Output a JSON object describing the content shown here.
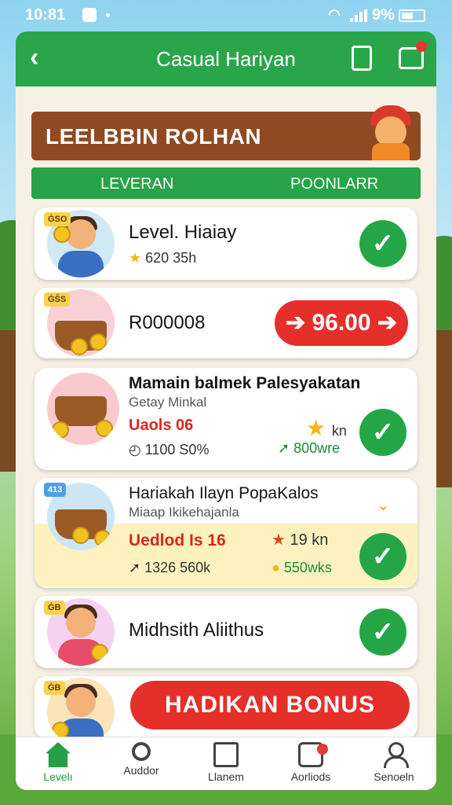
{
  "status_bar": {
    "time": "10:81",
    "battery": "9%"
  },
  "app_bar": {
    "back_icon": "‹",
    "title": "Casual Hariyan"
  },
  "banner": {
    "text": "LEELBBIN ROLHAN"
  },
  "tabs": [
    {
      "label": "LEVERAN"
    },
    {
      "label": "POONLARR"
    }
  ],
  "rows": [
    {
      "tag": "ĠSO",
      "title": "Level. Hiaiay",
      "meta": "620  35h",
      "check": "✓"
    },
    {
      "tag": "ĠŜS",
      "title": "R000008",
      "button": "➔ 96.00 ➔"
    },
    {
      "title": "Mamain balmek Palesyakatan",
      "sub": "Getay Minkal",
      "label": "Uaols 06",
      "meta": "1100  S0%",
      "right_top": "kn",
      "right_bottom": "800wre",
      "check": "✓"
    },
    {
      "tag": "413",
      "title": "Hariakah Ilayn PopaKalos",
      "sub": "Miaap Ikikehajanla",
      "label": "Uedlod Is 16",
      "meta": "1326  560k",
      "right_top": "19 kn",
      "right_bottom": "550wks",
      "check": "✓"
    },
    {
      "tag": "ĠB",
      "title": "Midhsith Aliithus",
      "check": "✓"
    },
    {
      "tag": "ĠB",
      "button": "HADIKAN BONUS"
    }
  ],
  "nav": [
    {
      "label": "Levelı",
      "icon": "home-icon"
    },
    {
      "label": "Auddor",
      "icon": "search-icon"
    },
    {
      "label": "Llanem",
      "icon": "edit-icon"
    },
    {
      "label": "Aorliods",
      "icon": "message-icon"
    },
    {
      "label": "Senoeln",
      "icon": "user-icon"
    }
  ],
  "colors": {
    "primary_green": "#2aa64a",
    "accent_red": "#e52f2a",
    "banner_brown": "#8f4a22"
  }
}
